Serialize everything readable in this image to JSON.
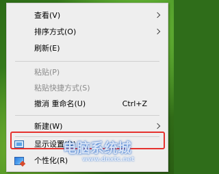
{
  "menu": {
    "view": {
      "label": "查看(V)"
    },
    "sort": {
      "label": "排序方式(O)"
    },
    "refresh": {
      "label": "刷新(E)"
    },
    "paste": {
      "label": "粘贴(P)"
    },
    "paste_shortcut": {
      "label": "粘贴快捷方式(S)"
    },
    "undo_rename": {
      "label": "撤消 重命名(U)",
      "shortcut": "Ctrl+Z"
    },
    "new": {
      "label": "新建(W)"
    },
    "display_settings": {
      "label": "显示设置(D)",
      "icon": "display-icon"
    },
    "personalize": {
      "label": "个性化(R)",
      "icon": "personalize-icon"
    }
  },
  "watermark": {
    "text": "电脑系统城",
    "url": "www.dnxtc.net"
  },
  "colors": {
    "highlight_box": "#e5312d",
    "menu_bg": "#eeeeee"
  }
}
